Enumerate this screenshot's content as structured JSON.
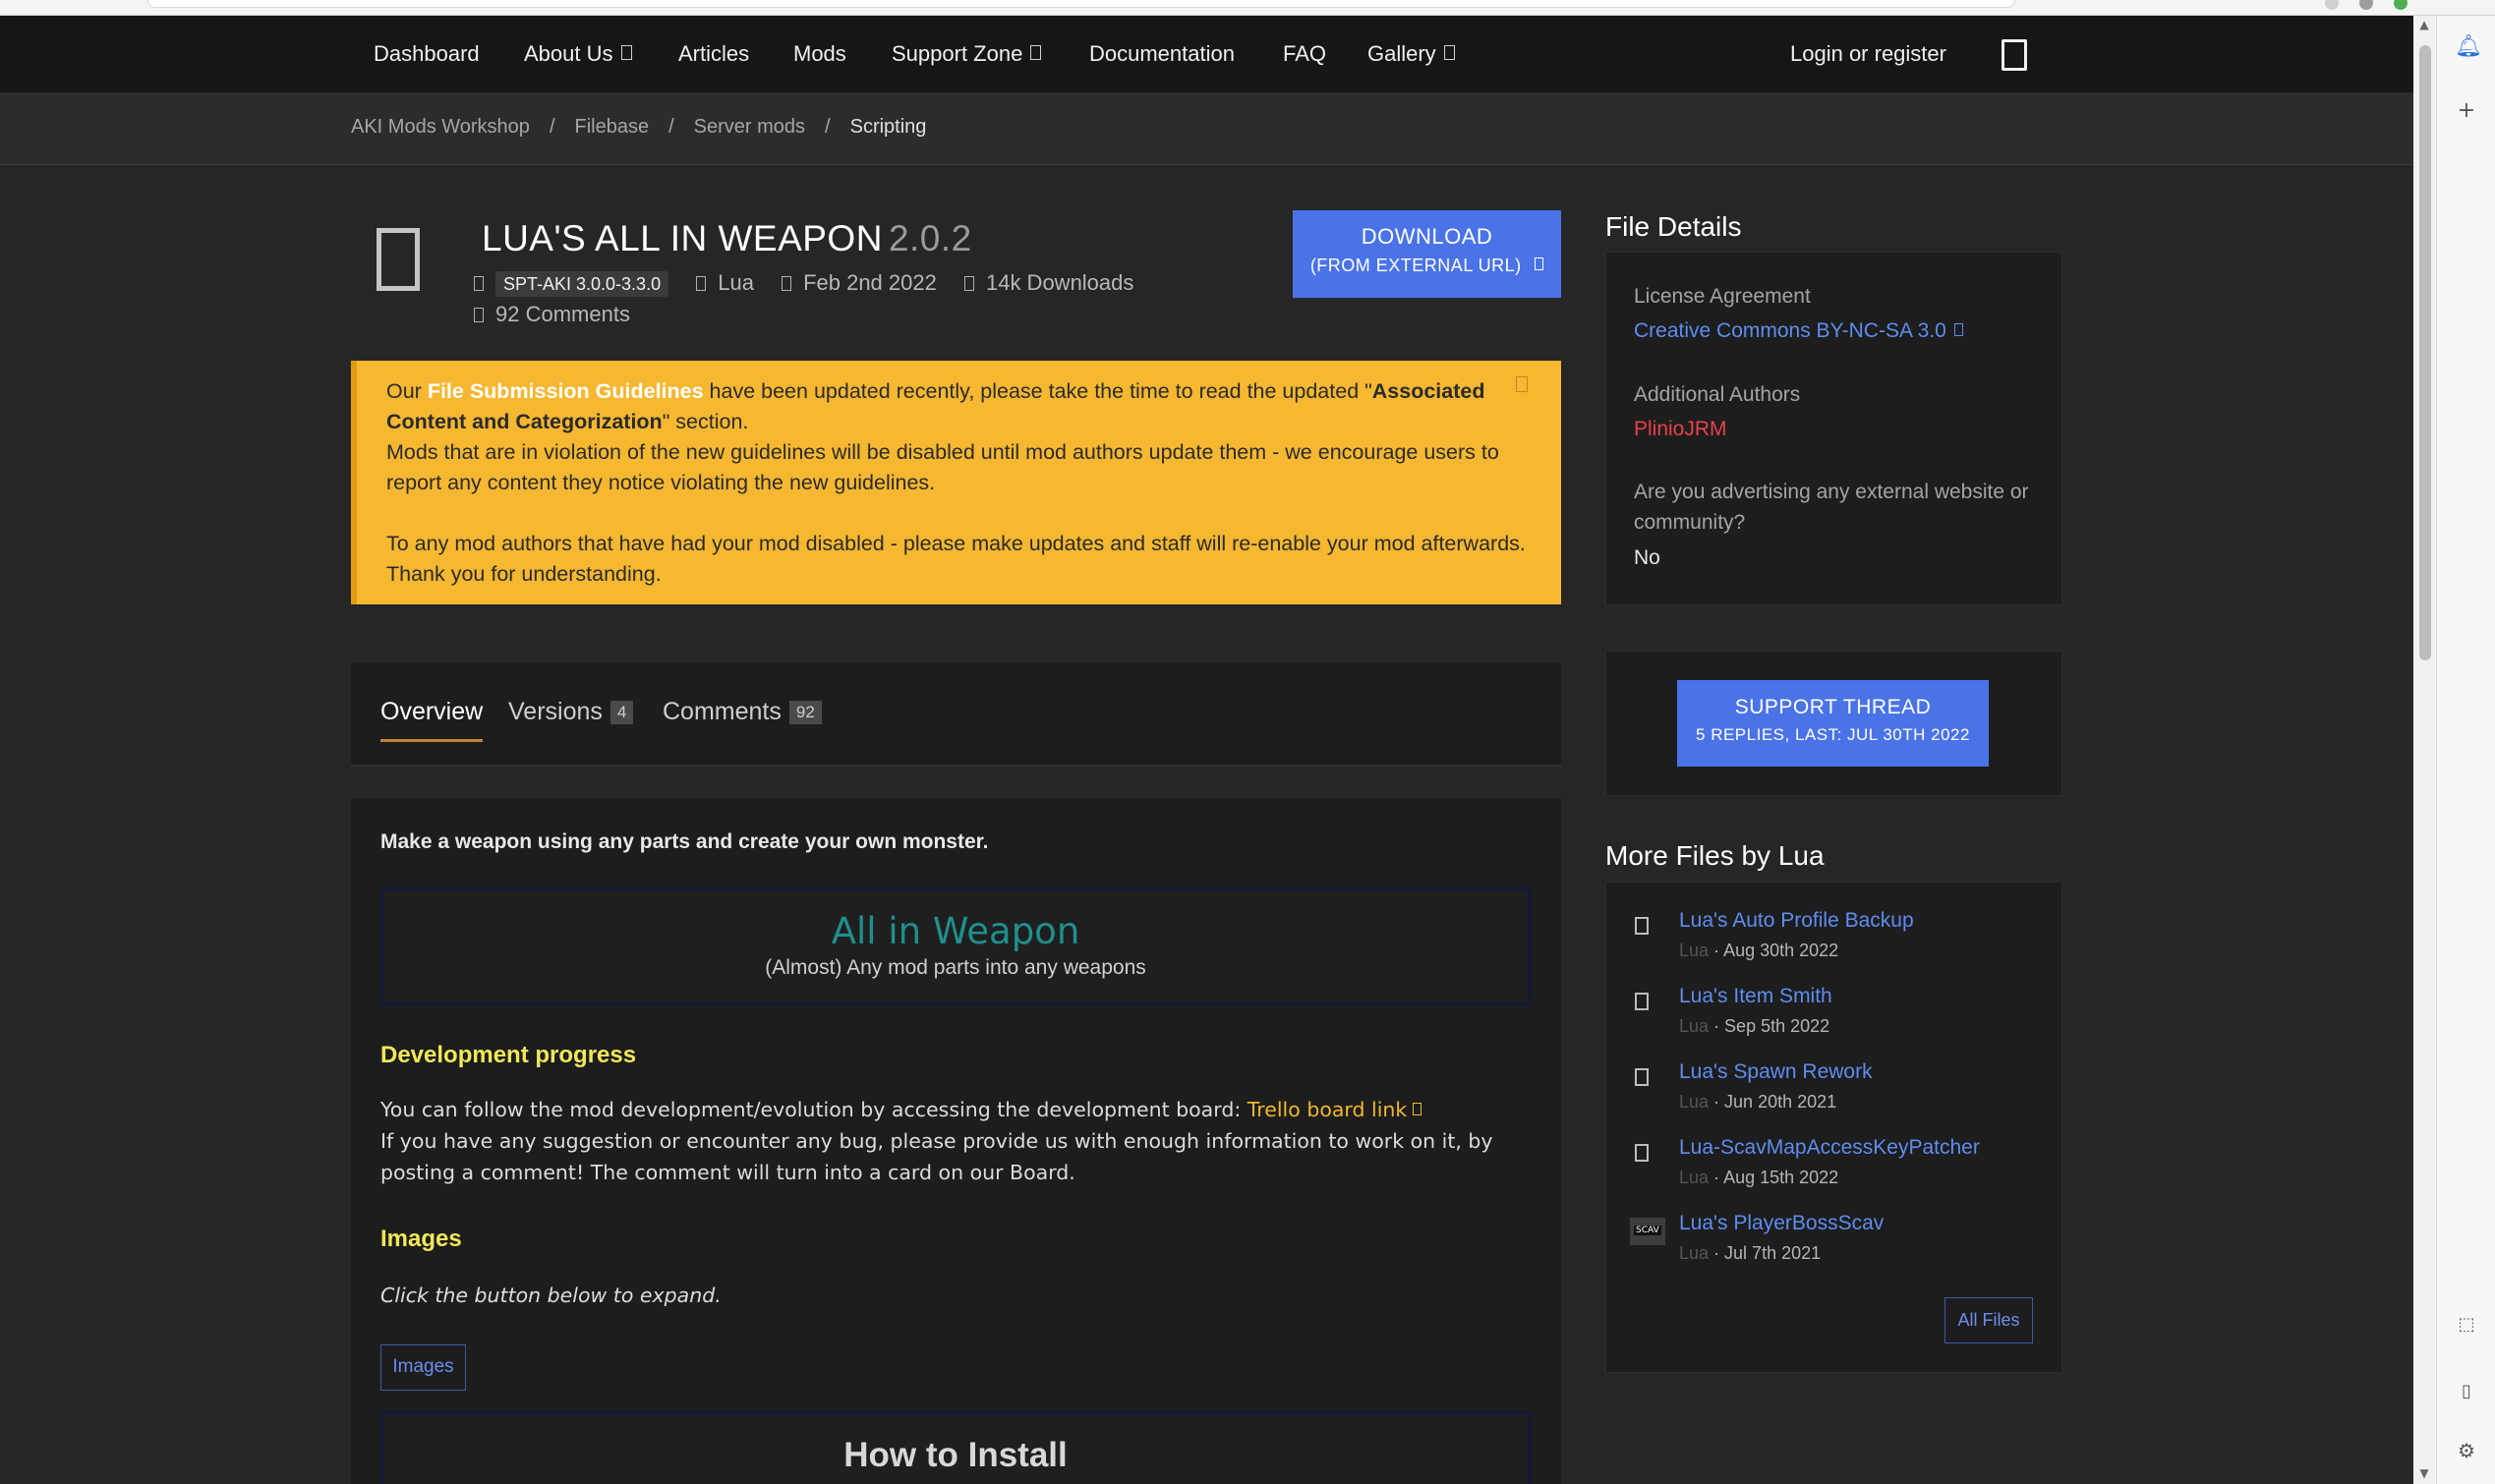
{
  "nav": {
    "items": [
      "Dashboard",
      "About Us",
      "Articles",
      "Mods",
      "Support Zone",
      "Documentation",
      "FAQ",
      "Gallery"
    ],
    "login": "Login or register"
  },
  "breadcrumb": [
    "AKI Mods Workshop",
    "/",
    "Filebase",
    "/",
    "Server mods",
    "/",
    "Scripting"
  ],
  "file": {
    "title": "LUA'S ALL IN WEAPON",
    "version": "2.0.2",
    "tag": "SPT-AKI 3.0.0-3.3.0",
    "author": "Lua",
    "date": "Feb 2nd 2022",
    "downloads": "14k Downloads",
    "comments": "92 Comments"
  },
  "download": {
    "line1": "DOWNLOAD",
    "line2": "(FROM EXTERNAL URL)"
  },
  "notice": {
    "p1_a": "Our ",
    "p1_link": "File Submission Guidelines",
    "p1_b": " have been updated recently, please take the time to read the updated \"",
    "p1_bold": "Associated Content and Categorization",
    "p1_c": "\" section.",
    "p2": "Mods that are in violation of the new guidelines will be disabled until mod authors update them - we encourage users to report any content they notice violating the new guidelines.",
    "p3": "To any mod authors that have had your mod disabled - please make updates and staff will re-enable your mod afterwards. Thank you for understanding."
  },
  "tabs": [
    {
      "label": "Overview",
      "badge": ""
    },
    {
      "label": "Versions",
      "badge": "4"
    },
    {
      "label": "Comments",
      "badge": "92"
    }
  ],
  "content": {
    "lead": "Make a weapon using any parts and create your own monster.",
    "banner_title": "All in Weapon",
    "banner_sub": "(Almost) Any mod parts into any weapons",
    "dev_heading": "Development progress",
    "dev_text_a": "You can follow the mod development/evolution by accessing the development board: ",
    "dev_link": "Trello board link",
    "dev_text_b": "If you have any suggestion or encounter any bug, please provide us with enough information to work on it, by posting a comment! The comment will turn into a card on our Board.",
    "images_heading": "Images",
    "images_hint": "Click the button below to expand.",
    "images_button": "Images",
    "install_title": "How to Install"
  },
  "details": {
    "heading": "File Details",
    "license_label": "License Agreement",
    "license_value": "Creative Commons BY-NC-SA 3.0",
    "authors_label": "Additional Authors",
    "authors_value": "PlinioJRM",
    "advert_label": "Are you advertising any external website or community?",
    "advert_value": "No"
  },
  "support": {
    "line1": "SUPPORT THREAD",
    "line2": "5 REPLIES, LAST: JUL 30TH 2022"
  },
  "more_files": {
    "heading": "More Files by Lua",
    "items": [
      {
        "name": "Lua's Auto Profile Backup",
        "author": "Lua",
        "date": "Aug 30th 2022"
      },
      {
        "name": "Lua's Item Smith",
        "author": "Lua",
        "date": "Sep 5th 2022"
      },
      {
        "name": "Lua's Spawn Rework",
        "author": "Lua",
        "date": "Jun 20th 2021"
      },
      {
        "name": "Lua-ScavMapAccessKeyPatcher",
        "author": "Lua",
        "date": "Aug 15th 2022"
      },
      {
        "name": "Lua's PlayerBossScav",
        "author": "Lua",
        "date": "Jul 7th 2021",
        "thumb": "SCAV"
      }
    ],
    "all_files": "All Files"
  },
  "colors": {
    "accent": "#4a73e8",
    "notice": "#f6b731",
    "heading_yellow": "#f1e85a",
    "link_blue": "#5e8df0",
    "author_red": "#e8414b"
  }
}
